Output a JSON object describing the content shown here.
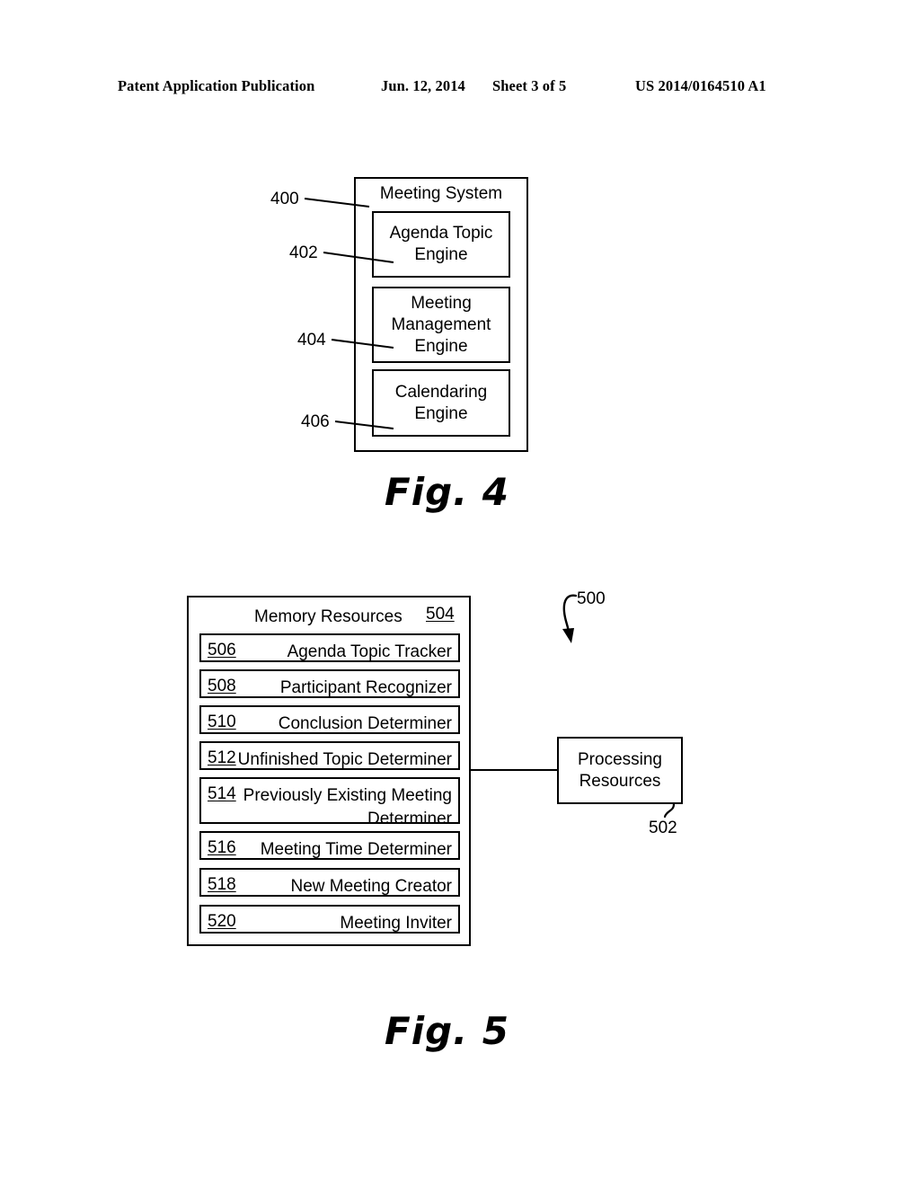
{
  "header": {
    "publication": "Patent Application Publication",
    "date": "Jun. 12, 2014",
    "sheet": "Sheet 3 of 5",
    "patent_number": "US 2014/0164510 A1"
  },
  "figures": [
    {
      "caption": "Fig. 4",
      "system": {
        "title": "Meeting System",
        "ref": "400",
        "engines": [
          {
            "ref": "402",
            "label": "Agenda Topic\nEngine"
          },
          {
            "ref": "404",
            "label": "Meeting\nManagement\nEngine"
          },
          {
            "ref": "406",
            "label": "Calendaring\nEngine"
          }
        ]
      }
    },
    {
      "caption": "Fig. 5",
      "system_ref": "500",
      "memory": {
        "title": "Memory Resources",
        "ref": "504",
        "items": [
          {
            "ref": "506",
            "label": "Agenda Topic Tracker"
          },
          {
            "ref": "508",
            "label": "Participant Recognizer"
          },
          {
            "ref": "510",
            "label": "Conclusion Determiner"
          },
          {
            "ref": "512",
            "label": "Unfinished Topic Determiner"
          },
          {
            "ref": "514",
            "label": "Previously Existing Meeting Determiner"
          },
          {
            "ref": "516",
            "label": "Meeting Time Determiner"
          },
          {
            "ref": "518",
            "label": "New Meeting Creator"
          },
          {
            "ref": "520",
            "label": "Meeting Inviter"
          }
        ]
      },
      "processing": {
        "label": "Processing\nResources",
        "ref": "502"
      }
    }
  ],
  "colors": {
    "ink": "#000000",
    "paper": "#ffffff"
  }
}
